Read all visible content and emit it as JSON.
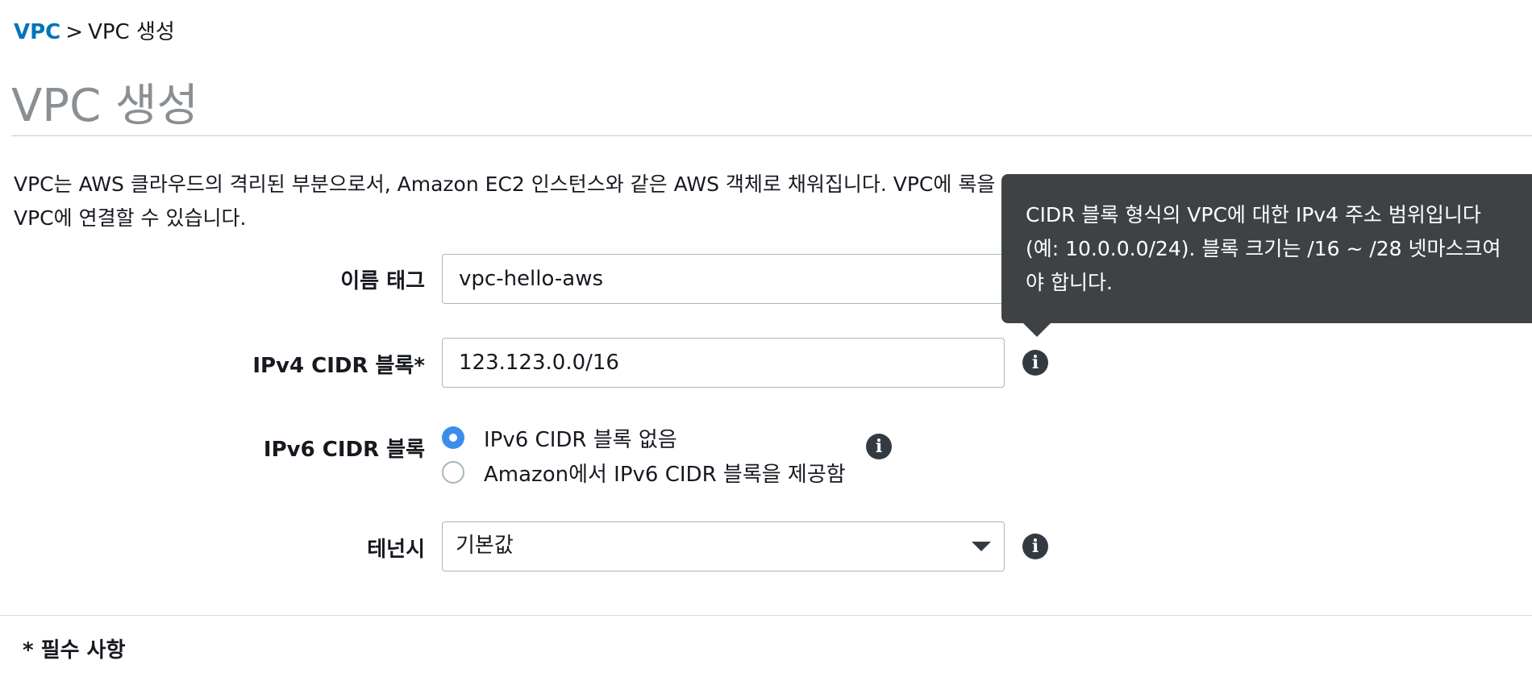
{
  "breadcrumb": {
    "root": "VPC",
    "separator": ">",
    "current": "VPC 생성"
  },
  "page": {
    "title": "VPC 생성",
    "description": "VPC는 AWS 클라우드의 격리된 부분으로서, Amazon EC2 인스턴스와 같은 AWS 객체로 채워집니다. VPC에 록을 VPC에 연결할 수 있습니다."
  },
  "form": {
    "name_tag": {
      "label": "이름 태그",
      "value": "vpc-hello-aws"
    },
    "ipv4_cidr": {
      "label": "IPv4 CIDR 블록*",
      "value": "123.123.0.0/16"
    },
    "ipv6_cidr": {
      "label": "IPv6 CIDR 블록",
      "options": [
        {
          "label": "IPv6 CIDR 블록 없음",
          "checked": true
        },
        {
          "label": "Amazon에서 IPv6 CIDR 블록을 제공함",
          "checked": false
        }
      ]
    },
    "tenancy": {
      "label": "테넌시",
      "selected": "기본값"
    },
    "info_icon_glyph": "i"
  },
  "footer": {
    "required_note": "* 필수 사항"
  },
  "tooltip": {
    "text": "CIDR 블록 형식의 VPC에 대한 IPv4 주소 범위입니다 (예: 10.0.0.0/24). 블록 크기는 /16 ~ /28 넷마스크여야 합니다."
  },
  "colors": {
    "link": "#0073bb",
    "radio_checked": "#3b8ded",
    "tooltip_bg": "#3f4245",
    "info_icon": "#333a42",
    "title_gray": "#8a8f93"
  }
}
